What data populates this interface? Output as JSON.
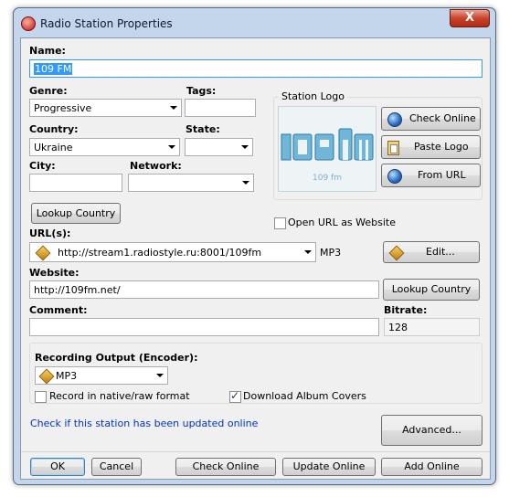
{
  "window": {
    "title": "Radio Station Properties",
    "close_label": "X"
  },
  "name": {
    "label": "Name:",
    "value": "109 FM"
  },
  "genre": {
    "label": "Genre:",
    "value": "Progressive"
  },
  "tags": {
    "label": "Tags:",
    "value": ""
  },
  "country": {
    "label": "Country:",
    "value": "Ukraine"
  },
  "state": {
    "label": "State:",
    "value": ""
  },
  "city": {
    "label": "City:",
    "value": ""
  },
  "network": {
    "label": "Network:",
    "value": ""
  },
  "lookup_country_1": "Lookup Country",
  "station_logo": {
    "label": "Station Logo",
    "logo_text": "109 fm",
    "check_online": "Check Online",
    "paste_logo": "Paste Logo",
    "from_url": "From URL",
    "open_url_label": "Open URL as Website",
    "open_url_checked": false
  },
  "urls": {
    "label": "URL(s):",
    "value": "http://stream1.radiostyle.ru:8001/109fm",
    "format": "MP3",
    "edit_label": "Edit..."
  },
  "website": {
    "label": "Website:",
    "value": "http://109fm.net/",
    "lookup_label": "Lookup Country"
  },
  "comment": {
    "label": "Comment:",
    "value": ""
  },
  "bitrate": {
    "label": "Bitrate:",
    "value": "128"
  },
  "recording": {
    "label": "Recording Output (Encoder):",
    "encoder": "MP3",
    "native_label": "Record in native/raw format",
    "native_checked": false,
    "covers_label": "Download Album Covers",
    "covers_checked": true
  },
  "update_link": "Check if this station has been updated online",
  "advanced_label": "Advanced...",
  "footer": {
    "ok": "OK",
    "cancel": "Cancel",
    "check_online": "Check Online",
    "update_online": "Update Online",
    "add_online": "Add Online"
  },
  "colors": {
    "accent": "#3399ff",
    "link": "#0033cc",
    "window_frame": "#c4d6ec"
  }
}
